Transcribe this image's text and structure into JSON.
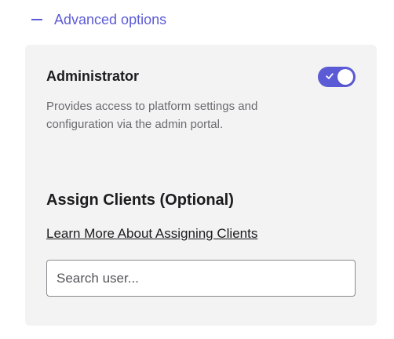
{
  "advanced": {
    "label": "Advanced options",
    "expanded": true,
    "icon": "minus-icon"
  },
  "admin": {
    "title": "Administrator",
    "description": "Provides access to platform settings and configuration via the admin portal.",
    "toggle_on": true,
    "toggle_icon": "check-icon"
  },
  "assign": {
    "title": "Assign Clients (Optional)",
    "learn_more": "Learn More About Assigning Clients",
    "search_placeholder": "Search user...",
    "search_value": ""
  },
  "colors": {
    "accent": "#5b5bd6",
    "panel_bg": "#f3f3f4",
    "muted_text": "#6b6b70"
  }
}
